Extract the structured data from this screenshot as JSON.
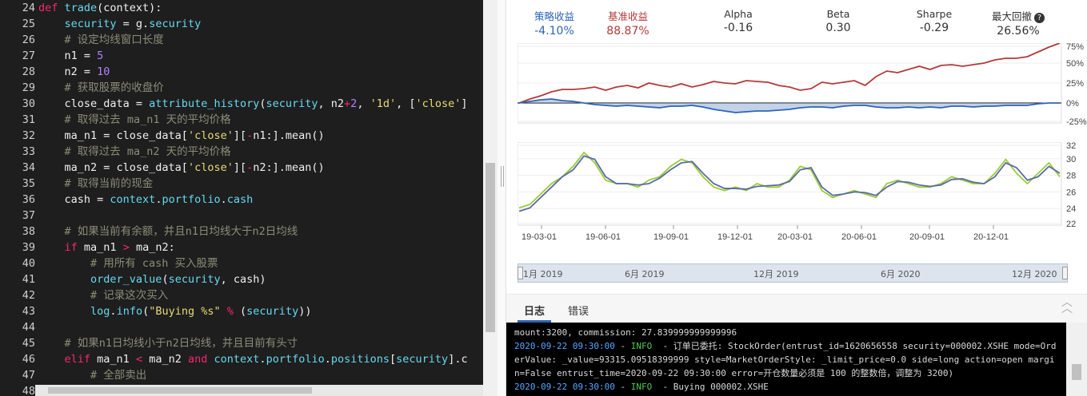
{
  "editor": {
    "lines": [
      {
        "num": "24",
        "seg": [
          [
            "k",
            "def "
          ],
          [
            "f",
            "trade"
          ],
          [
            "",
            "(context):"
          ]
        ]
      },
      {
        "num": "25",
        "seg": [
          [
            "",
            "    "
          ],
          [
            "v",
            "security"
          ],
          [
            "",
            " = g."
          ],
          [
            "v",
            "security"
          ]
        ]
      },
      {
        "num": "26",
        "seg": [
          [
            "c",
            "    # 设定均线窗口长度"
          ]
        ]
      },
      {
        "num": "27",
        "seg": [
          [
            "",
            "    n1 = "
          ],
          [
            "n",
            "5"
          ]
        ]
      },
      {
        "num": "28",
        "seg": [
          [
            "",
            "    n2 = "
          ],
          [
            "n",
            "10"
          ]
        ]
      },
      {
        "num": "29",
        "seg": [
          [
            "c",
            "    # 获取股票的收盘价"
          ]
        ]
      },
      {
        "num": "30",
        "seg": [
          [
            "",
            "    close_data = "
          ],
          [
            "f",
            "attribute_history"
          ],
          [
            "",
            "("
          ],
          [
            "v",
            "security"
          ],
          [
            "",
            ", n2"
          ],
          [
            "k",
            "+"
          ],
          [
            "n",
            "2"
          ],
          [
            "",
            ", "
          ],
          [
            "s",
            "'1d'"
          ],
          [
            "",
            ", ["
          ],
          [
            "s",
            "'close'"
          ],
          [
            "",
            "]"
          ]
        ]
      },
      {
        "num": "31",
        "seg": [
          [
            "c",
            "    # 取得过去 ma_n1 天的平均价格"
          ]
        ]
      },
      {
        "num": "32",
        "seg": [
          [
            "",
            "    ma_n1 = close_data["
          ],
          [
            "s",
            "'close'"
          ],
          [
            "",
            "]["
          ],
          [
            "k",
            "-"
          ],
          [
            "",
            "n1:].mean()"
          ]
        ]
      },
      {
        "num": "33",
        "seg": [
          [
            "c",
            "    # 取得过去 ma_n2 天的平均价格"
          ]
        ]
      },
      {
        "num": "34",
        "seg": [
          [
            "",
            "    ma_n2 = close_data["
          ],
          [
            "s",
            "'close'"
          ],
          [
            "",
            "]["
          ],
          [
            "k",
            "-"
          ],
          [
            "",
            "n2:].mean()"
          ]
        ]
      },
      {
        "num": "35",
        "seg": [
          [
            "c",
            "    # 取得当前的现金"
          ]
        ]
      },
      {
        "num": "36",
        "seg": [
          [
            "",
            "    cash = "
          ],
          [
            "v",
            "context"
          ],
          [
            "",
            "."
          ],
          [
            "v",
            "portfolio"
          ],
          [
            "",
            "."
          ],
          [
            "v",
            "cash"
          ]
        ]
      },
      {
        "num": "37",
        "seg": []
      },
      {
        "num": "38",
        "seg": [
          [
            "c",
            "    # 如果当前有余额，并且n1日均线大于n2日均线"
          ]
        ]
      },
      {
        "num": "39",
        "seg": [
          [
            "",
            "    "
          ],
          [
            "k",
            "if"
          ],
          [
            "",
            " ma_n1 "
          ],
          [
            "k",
            ">"
          ],
          [
            "",
            " ma_n2:"
          ]
        ]
      },
      {
        "num": "40",
        "seg": [
          [
            "c",
            "        # 用所有 cash 买入股票"
          ]
        ]
      },
      {
        "num": "41",
        "seg": [
          [
            "",
            "        "
          ],
          [
            "f",
            "order_value"
          ],
          [
            "",
            "("
          ],
          [
            "v",
            "security"
          ],
          [
            "",
            ", cash)"
          ]
        ]
      },
      {
        "num": "42",
        "seg": [
          [
            "c",
            "        # 记录这次买入"
          ]
        ]
      },
      {
        "num": "43",
        "seg": [
          [
            "",
            "        "
          ],
          [
            "v",
            "log"
          ],
          [
            "",
            "."
          ],
          [
            "v",
            "info"
          ],
          [
            "",
            "("
          ],
          [
            "s",
            "\"Buying %s\""
          ],
          [
            "",
            " "
          ],
          [
            "k",
            "%"
          ],
          [
            "",
            " ("
          ],
          [
            "v",
            "security"
          ],
          [
            "",
            "))"
          ]
        ]
      },
      {
        "num": "44",
        "seg": []
      },
      {
        "num": "45",
        "seg": [
          [
            "c",
            "    # 如果n1日均线小于n2日均线，并且目前有头寸"
          ]
        ]
      },
      {
        "num": "46",
        "seg": [
          [
            "",
            "    "
          ],
          [
            "k",
            "elif"
          ],
          [
            "",
            " ma_n1 "
          ],
          [
            "k",
            "<"
          ],
          [
            "",
            " ma_n2 "
          ],
          [
            "k",
            "and"
          ],
          [
            "",
            " "
          ],
          [
            "v",
            "context"
          ],
          [
            "",
            "."
          ],
          [
            "v",
            "portfolio"
          ],
          [
            "",
            "."
          ],
          [
            "v",
            "positions"
          ],
          [
            "",
            "["
          ],
          [
            "v",
            "security"
          ],
          [
            "",
            "].c"
          ]
        ]
      },
      {
        "num": "47",
        "seg": [
          [
            "c",
            "        # 全部卖出"
          ]
        ]
      },
      {
        "num": "48",
        "seg": []
      }
    ]
  },
  "metrics": [
    {
      "label": "策略收益",
      "value": "-4.10%",
      "color": "#2e64b4"
    },
    {
      "label": "基准收益",
      "value": "88.87%",
      "color": "#b33a3a"
    },
    {
      "label": "Alpha",
      "value": "-0.16",
      "color": "#333333"
    },
    {
      "label": "Beta",
      "value": "0.30",
      "color": "#333333"
    },
    {
      "label": "Sharpe",
      "value": "-0.29",
      "color": "#333333"
    },
    {
      "label": "最大回撤",
      "value": "26.56%",
      "color": "#333333"
    }
  ],
  "help_icon": "question-circle-icon",
  "chart_data": [
    {
      "type": "line",
      "yticks": [
        "75%",
        "50%",
        "25%",
        "0%",
        "-25%"
      ],
      "ylim": [
        -25,
        75
      ],
      "x": [
        0,
        2,
        4,
        6,
        8,
        10,
        12,
        14,
        16,
        18,
        20,
        22,
        24,
        26,
        28,
        30,
        32,
        34,
        36,
        38,
        40,
        42,
        44,
        46,
        48,
        50,
        52,
        54,
        56,
        58,
        60,
        62,
        64,
        66,
        68,
        70,
        72,
        74,
        76,
        78,
        80,
        82,
        84,
        86,
        88,
        90,
        92,
        94,
        96,
        98,
        100
      ],
      "series": [
        {
          "color": "#b33a3a",
          "values": [
            0,
            5,
            9,
            14,
            17,
            17,
            18,
            20,
            16,
            20,
            22,
            19,
            25,
            22,
            20,
            24,
            20,
            23,
            27,
            25,
            24,
            28,
            27,
            26,
            22,
            20,
            16,
            18,
            26,
            24,
            26,
            28,
            22,
            33,
            40,
            38,
            42,
            46,
            42,
            47,
            48,
            46,
            48,
            50,
            54,
            56,
            56,
            58,
            64,
            70,
            75
          ]
        },
        {
          "color": "#2e64b4",
          "values": [
            0,
            2,
            4,
            5,
            3,
            2,
            0,
            -2,
            -3,
            -4,
            -3,
            -4,
            -5,
            -6,
            -4,
            -4,
            -3,
            -5,
            -8,
            -10,
            -12,
            -11,
            -10,
            -10,
            -9,
            -8,
            -6,
            -5,
            -5,
            -6,
            -4,
            -3,
            -3,
            -5,
            -6,
            -6,
            -5,
            -6,
            -5,
            -6,
            -4,
            -4,
            -5,
            -4,
            -4,
            -3,
            -3,
            -3,
            -1,
            0,
            0
          ]
        }
      ]
    },
    {
      "type": "line",
      "yticks": [
        "32",
        "30",
        "28",
        "26",
        "24",
        "22"
      ],
      "ylim": [
        21,
        33
      ],
      "xticks": [
        "19-03-01",
        "19-06-01",
        "19-09-01",
        "19-12-01",
        "20-03-01",
        "20-06-01",
        "20-09-01",
        "20-12-01"
      ],
      "x": [
        0,
        2,
        4,
        6,
        8,
        10,
        12,
        14,
        16,
        18,
        20,
        22,
        24,
        26,
        28,
        30,
        32,
        34,
        36,
        38,
        40,
        42,
        44,
        46,
        48,
        50,
        52,
        54,
        56,
        58,
        60,
        62,
        64,
        66,
        68,
        70,
        72,
        74,
        76,
        78,
        80,
        82,
        84,
        86,
        88,
        90,
        92,
        94,
        96,
        98,
        100
      ],
      "series": [
        {
          "color": "#9acd32",
          "values": [
            23.5,
            24,
            25.5,
            27,
            28,
            29.5,
            31.5,
            30,
            27.5,
            27,
            27,
            26.5,
            27.5,
            28,
            29.5,
            30.5,
            30,
            28,
            26.5,
            26,
            26.5,
            26,
            27,
            26.5,
            26.5,
            27.5,
            29.5,
            29,
            26,
            25,
            25.5,
            26,
            25.5,
            25,
            27,
            27.5,
            27,
            26.5,
            26.5,
            27,
            28,
            27.5,
            27,
            27,
            28.5,
            30.5,
            28.5,
            27,
            28.5,
            30,
            28
          ]
        },
        {
          "color": "#5a6aa8",
          "values": [
            23,
            23.5,
            25,
            26.5,
            28,
            29,
            31,
            30.5,
            28,
            27,
            27,
            26.8,
            27,
            27.8,
            29,
            30,
            30.2,
            28.5,
            27,
            26.3,
            26.3,
            26.2,
            26.6,
            26.7,
            26.8,
            27.3,
            29,
            29.3,
            26.5,
            25.3,
            25.5,
            25.8,
            25.7,
            25.3,
            26.5,
            27.3,
            27.2,
            26.8,
            26.6,
            26.8,
            27.6,
            27.7,
            27.2,
            27,
            28,
            30,
            29.3,
            27.5,
            28,
            29.5,
            28.5
          ]
        }
      ]
    }
  ],
  "navigator": {
    "labels": [
      "1月 2019",
      "6月 2019",
      "12月 2019",
      "6月 2020",
      "12月 2020"
    ]
  },
  "tabs": {
    "log": "日志",
    "error": "错误"
  },
  "log": [
    {
      "parts": [
        [
          "",
          "mount:3200, commission: 27.839999999999996"
        ]
      ]
    },
    {
      "parts": [
        [
          "ts",
          "2020-09-22 09:30:00"
        ],
        [
          "",
          " - "
        ],
        [
          "info",
          "INFO"
        ],
        [
          "",
          "  - 订单已委托: StockOrder(entrust_id=1620656558 security=000002.XSHE mode=Ord"
        ]
      ]
    },
    {
      "parts": [
        [
          "",
          "erValue: _value=93315.09518399999 style=MarketOrderStyle: _limit_price=0.0 side=long action=open margi"
        ]
      ]
    },
    {
      "parts": [
        [
          "",
          "n=False entrust_time=2020-09-22 09:30:00 error=开仓数量必须是 100 的整数倍，调整为 3200)"
        ]
      ]
    },
    {
      "parts": [
        [
          "ts",
          "2020-09-22 09:30:00"
        ],
        [
          "",
          " - "
        ],
        [
          "info",
          "INFO"
        ],
        [
          "",
          "  - Buying 000002.XSHE"
        ]
      ]
    }
  ]
}
